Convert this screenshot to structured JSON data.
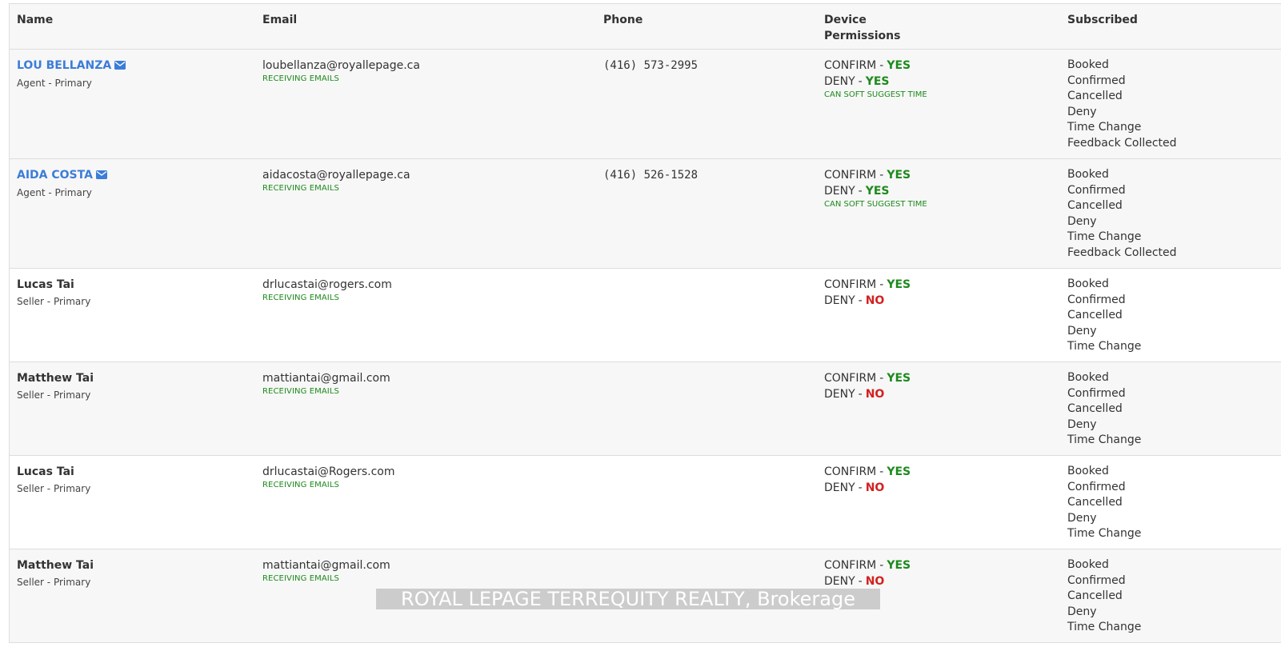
{
  "headers": {
    "name": "Name",
    "email": "Email",
    "phone": "Phone",
    "permissions_line1": "Device",
    "permissions_line2": "Permissions",
    "subscribed": "Subscribed"
  },
  "labels": {
    "confirm": "CONFIRM",
    "deny": "DENY",
    "separator": "-",
    "receiving": "RECEIVING EMAILS",
    "soft_suggest": "CAN SOFT SUGGEST TIME"
  },
  "colors": {
    "link": "#3b7dd8",
    "yes": "#1c8a1c",
    "no": "#d42020"
  },
  "rows": [
    {
      "name": "LOU BELLANZA",
      "role": "Agent - Primary",
      "email": "loubellanza@royallepage.ca",
      "phone": "(416) 573-2995",
      "confirm": "YES",
      "deny": "YES",
      "subscribed": [
        "Booked",
        "Confirmed",
        "Cancelled",
        "Deny",
        "Time Change",
        "Feedback Collected"
      ]
    },
    {
      "name": "AIDA COSTA",
      "role": "Agent - Primary",
      "email": "aidacosta@royallepage.ca",
      "phone": "(416) 526-1528",
      "confirm": "YES",
      "deny": "YES",
      "subscribed": [
        "Booked",
        "Confirmed",
        "Cancelled",
        "Deny",
        "Time Change",
        "Feedback Collected"
      ]
    },
    {
      "name": "Lucas Tai",
      "role": "Seller - Primary",
      "email": "drlucastai@rogers.com",
      "confirm": "YES",
      "deny": "NO",
      "subscribed": [
        "Booked",
        "Confirmed",
        "Cancelled",
        "Deny",
        "Time Change"
      ]
    },
    {
      "name": "Matthew Tai",
      "role": "Seller - Primary",
      "email": "mattiantai@gmail.com",
      "confirm": "YES",
      "deny": "NO",
      "subscribed": [
        "Booked",
        "Confirmed",
        "Cancelled",
        "Deny",
        "Time Change"
      ]
    },
    {
      "name": "Lucas Tai",
      "role": "Seller - Primary",
      "email": "drlucastai@Rogers.com",
      "confirm": "YES",
      "deny": "NO",
      "subscribed": [
        "Booked",
        "Confirmed",
        "Cancelled",
        "Deny",
        "Time Change"
      ]
    },
    {
      "name": "Matthew Tai",
      "role": "Seller - Primary",
      "email": "mattiantai@gmail.com",
      "confirm": "YES",
      "deny": "NO",
      "subscribed": [
        "Booked",
        "Confirmed",
        "Cancelled",
        "Deny",
        "Time Change"
      ]
    }
  ],
  "watermark": "ROYAL LEPAGE TERREQUITY REALTY, Brokerage"
}
